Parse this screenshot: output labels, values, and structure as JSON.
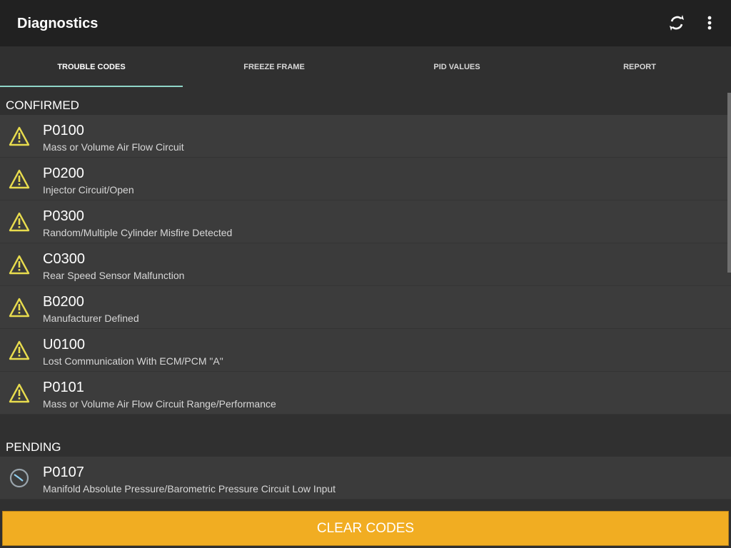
{
  "app": {
    "title": "Diagnostics",
    "icons": {
      "refresh": "refresh-icon",
      "more": "more-vert-icon"
    }
  },
  "tabs": [
    {
      "label": "TROUBLE CODES",
      "active": true
    },
    {
      "label": "FREEZE FRAME",
      "active": false
    },
    {
      "label": "PID VALUES",
      "active": false
    },
    {
      "label": "REPORT",
      "active": false
    }
  ],
  "sections": {
    "confirmed": {
      "title": "CONFIRMED",
      "items": [
        {
          "code": "P0100",
          "description": "Mass or Volume Air Flow Circuit"
        },
        {
          "code": "P0200",
          "description": "Injector Circuit/Open"
        },
        {
          "code": "P0300",
          "description": "Random/Multiple Cylinder Misfire Detected"
        },
        {
          "code": "C0300",
          "description": "Rear Speed Sensor Malfunction"
        },
        {
          "code": "B0200",
          "description": "Manufacturer Defined"
        },
        {
          "code": "U0100",
          "description": "Lost Communication With ECM/PCM \"A\""
        },
        {
          "code": "P0101",
          "description": "Mass or Volume Air Flow Circuit Range/Performance"
        }
      ]
    },
    "pending": {
      "title": "PENDING",
      "items": [
        {
          "code": "P0107",
          "description": "Manifold Absolute Pressure/Barometric Pressure Circuit Low Input"
        }
      ]
    }
  },
  "buttons": {
    "clear_codes": "CLEAR CODES"
  },
  "colors": {
    "accent": "#f1ad22",
    "tab_indicator": "#8fd6c8",
    "warning": "#e8dc4e"
  }
}
